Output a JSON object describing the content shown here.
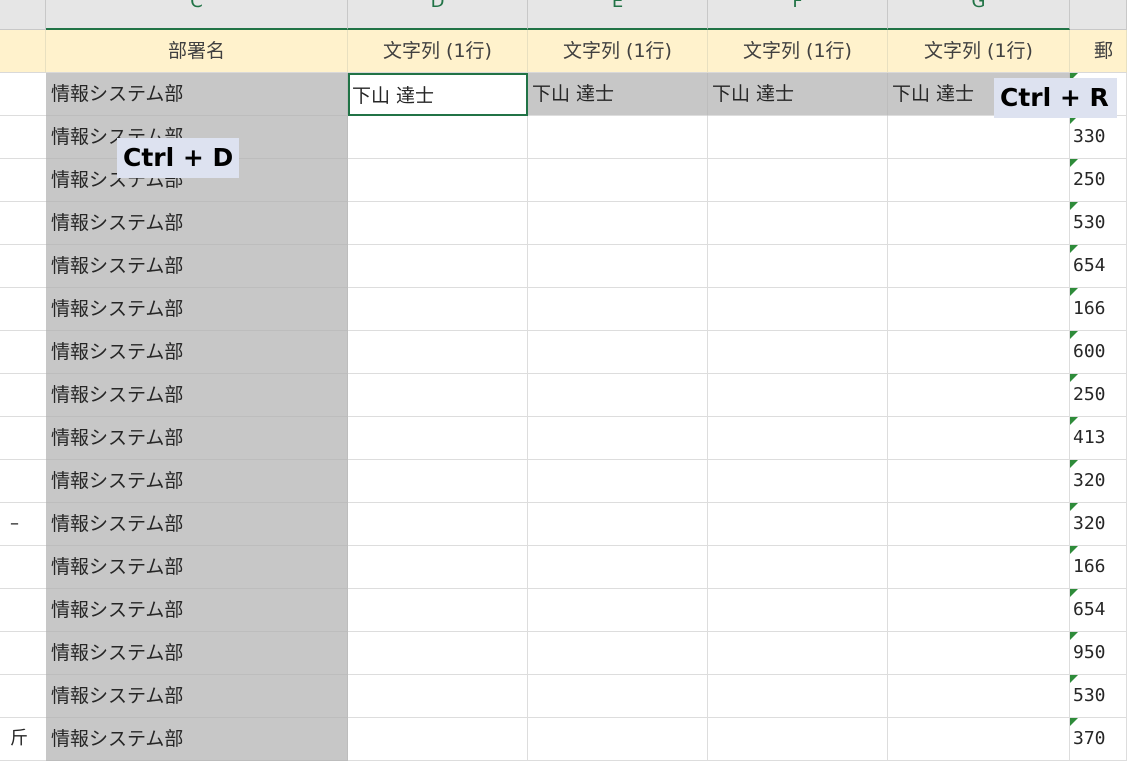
{
  "column_headers": [
    "C",
    "D",
    "E",
    "F",
    "G"
  ],
  "header_row": {
    "c": "部署名",
    "d": "文字列 (1行)",
    "e": "文字列 (1行)",
    "f": "文字列 (1行)",
    "g": "文字列 (1行)",
    "h": "郵"
  },
  "fill_row": {
    "d": "下山 達士",
    "e": "下山 達士",
    "f": "下山 達士",
    "g": "下山 達士"
  },
  "rows": [
    {
      "stub": "",
      "dept": "情報システム部",
      "h": ""
    },
    {
      "stub": "",
      "dept": "情報システム部",
      "h": "330"
    },
    {
      "stub": "",
      "dept": "情報システム部",
      "h": "250"
    },
    {
      "stub": "",
      "dept": "情報システム部",
      "h": "530"
    },
    {
      "stub": "",
      "dept": "情報システム部",
      "h": "654"
    },
    {
      "stub": "",
      "dept": "情報システム部",
      "h": "166"
    },
    {
      "stub": "",
      "dept": "情報システム部",
      "h": "600"
    },
    {
      "stub": "",
      "dept": "情報システム部",
      "h": "250"
    },
    {
      "stub": "",
      "dept": "情報システム部",
      "h": "413"
    },
    {
      "stub": "",
      "dept": "情報システム部",
      "h": "320"
    },
    {
      "stub": "–",
      "dept": "情報システム部",
      "h": "320"
    },
    {
      "stub": "",
      "dept": "情報システム部",
      "h": "166"
    },
    {
      "stub": "",
      "dept": "情報システム部",
      "h": "654"
    },
    {
      "stub": "",
      "dept": "情報システム部",
      "h": "950"
    },
    {
      "stub": "",
      "dept": "情報システム部",
      "h": "530"
    },
    {
      "stub": "斤",
      "dept": "情報システム部",
      "h": "370"
    }
  ],
  "shortcuts": {
    "fill_down": "Ctrl + D",
    "fill_right": "Ctrl + R"
  },
  "colors": {
    "accent": "#217346",
    "header_fill": "#fff2cc",
    "selection_gray": "#c7c7c7",
    "overlay": "#dde2f0"
  }
}
